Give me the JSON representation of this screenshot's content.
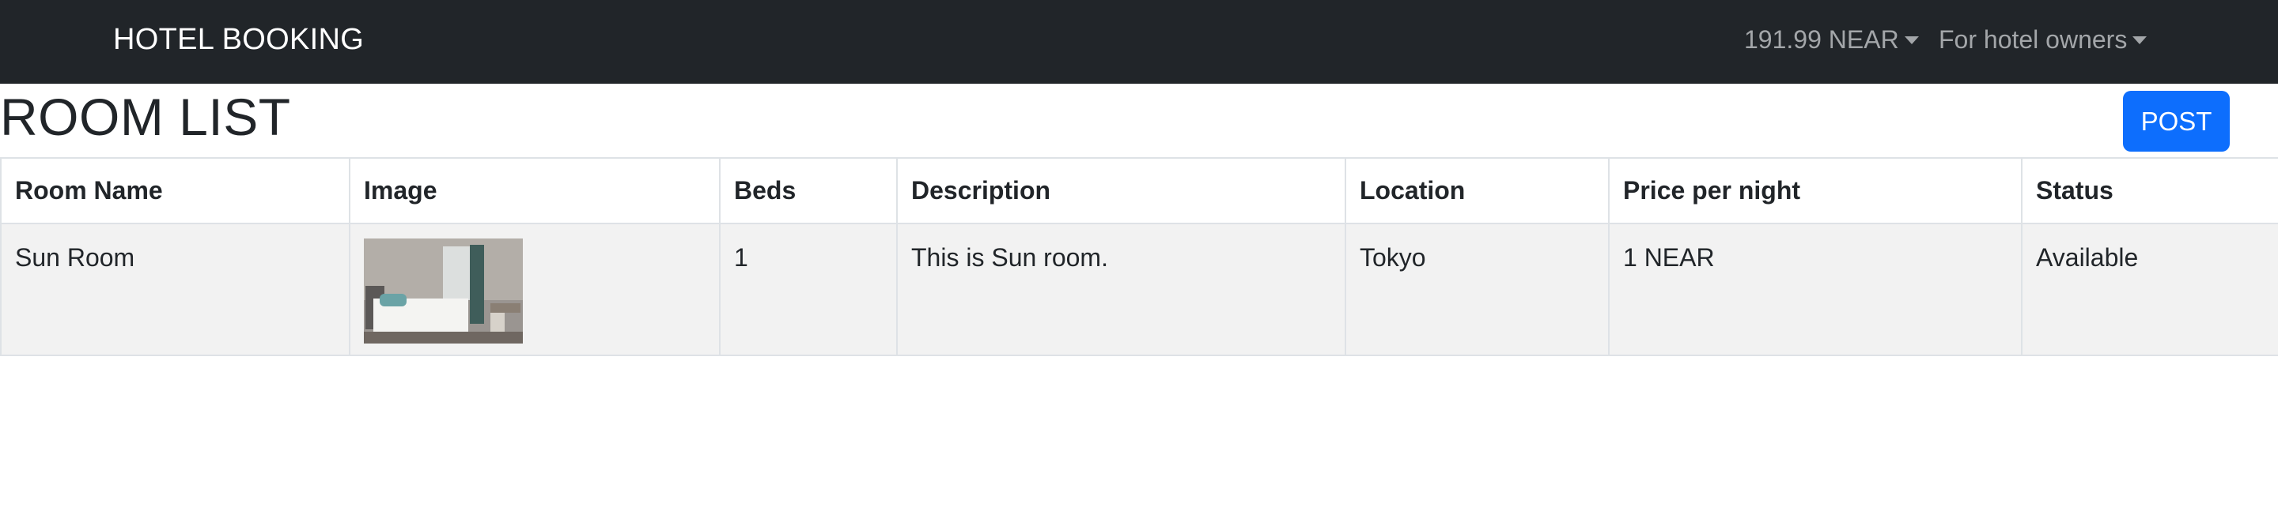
{
  "navbar": {
    "brand": "HOTEL BOOKING",
    "balance_dropdown": "191.99 NEAR",
    "owners_dropdown": "For hotel owners",
    "background_color": "#212529",
    "caret_icon": "caret-down-icon"
  },
  "page": {
    "title": "ROOM LIST",
    "post_button": "POST",
    "post_button_color": "#0d6efd"
  },
  "table": {
    "headers": {
      "room_name": "Room Name",
      "image": "Image",
      "beds": "Beds",
      "description": "Description",
      "location": "Location",
      "price": "Price per night",
      "status": "Status"
    },
    "rows": [
      {
        "room_name": "Sun Room",
        "image": "hotel-room-photo",
        "beds": "1",
        "description": "This is Sun room.",
        "location": "Tokyo",
        "price": "1 NEAR",
        "status": "Available"
      }
    ]
  }
}
